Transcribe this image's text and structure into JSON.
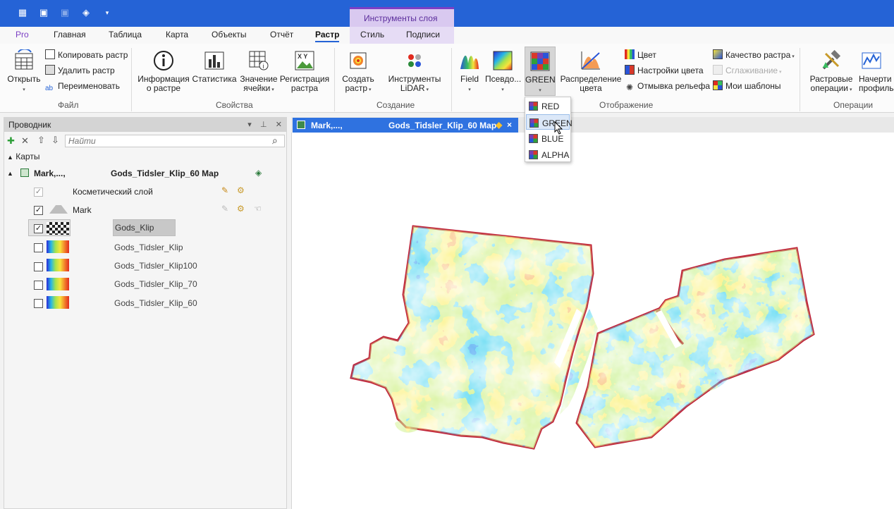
{
  "quick_access": {
    "icons": [
      "grid-icon",
      "save-icon",
      "disabled-save-icon",
      "layers-icon",
      "customize-icon"
    ]
  },
  "contextual_group": {
    "label": "Инструменты слоя"
  },
  "tabs": {
    "pro": "Pro",
    "home": "Главная",
    "table": "Таблица",
    "map": "Карта",
    "objects": "Объекты",
    "report": "Отчёт",
    "raster": "Растр",
    "style": "Стиль",
    "labels": "Подписи"
  },
  "ribbon": {
    "file": {
      "open": "Открыть",
      "copy": "Копировать растр",
      "delete": "Удалить растр",
      "rename": "Переименовать",
      "group": "Файл"
    },
    "properties": {
      "info_1": "Информация",
      "info_2": "о растре",
      "stats": "Статистика",
      "cell_1": "Значение",
      "cell_2": "ячейки",
      "reg_1": "Регистрация",
      "reg_2": "растра",
      "group": "Свойства"
    },
    "create": {
      "create_1": "Создать",
      "create_2": "растр",
      "lidar_1": "Инструменты",
      "lidar_2": "LiDAR",
      "group": "Создание"
    },
    "display": {
      "field": "Field",
      "pseudo": "Псевдо...",
      "band": "GREEN",
      "dist_1": "Распределение",
      "dist_2": "цвета",
      "color": "Цвет",
      "color_settings": "Настройки цвета",
      "relief": "Отмывка рельефа",
      "quality": "Качество растра",
      "smoothing": "Сглаживание",
      "templates": "Мои шаблоны",
      "group": "Отображение"
    },
    "operations": {
      "raster_ops_1": "Растровые",
      "raster_ops_2": "операции",
      "profile_1": "Начерти",
      "profile_2": "профиль",
      "group": "Операции"
    }
  },
  "explorer": {
    "title": "Проводник",
    "search_placeholder": "Найти",
    "maps_label": "Карты",
    "map_name_left": "Mark,...,",
    "map_name_right": "Gods_Tidsler_Klip_60 Map",
    "layers": [
      {
        "name": "Косметический слой",
        "checked": true
      },
      {
        "name": "Mark",
        "checked": true
      },
      {
        "name": "Gods_Klip",
        "checked": true
      },
      {
        "name": "Gods_Tidsler_Klip",
        "checked": false
      },
      {
        "name": "Gods_Tidsler_Klip100",
        "checked": false
      },
      {
        "name": "Gods_Tidsler_Klip_70",
        "checked": false
      },
      {
        "name": "Gods_Tidsler_Klip_60",
        "checked": false
      }
    ]
  },
  "map_tab": {
    "left": "Mark,...,",
    "right": "Gods_Tidsler_Klip_60 Map",
    "close": "×"
  },
  "band_dropdown": {
    "options": [
      "RED",
      "GREEN",
      "BLUE",
      "ALPHA"
    ],
    "hovered": "GREEN"
  },
  "colors": {
    "accent": "#2563d6",
    "context": "#7b3fc4",
    "map_high": "#e12b1f",
    "map_low": "#2a2ad8"
  }
}
